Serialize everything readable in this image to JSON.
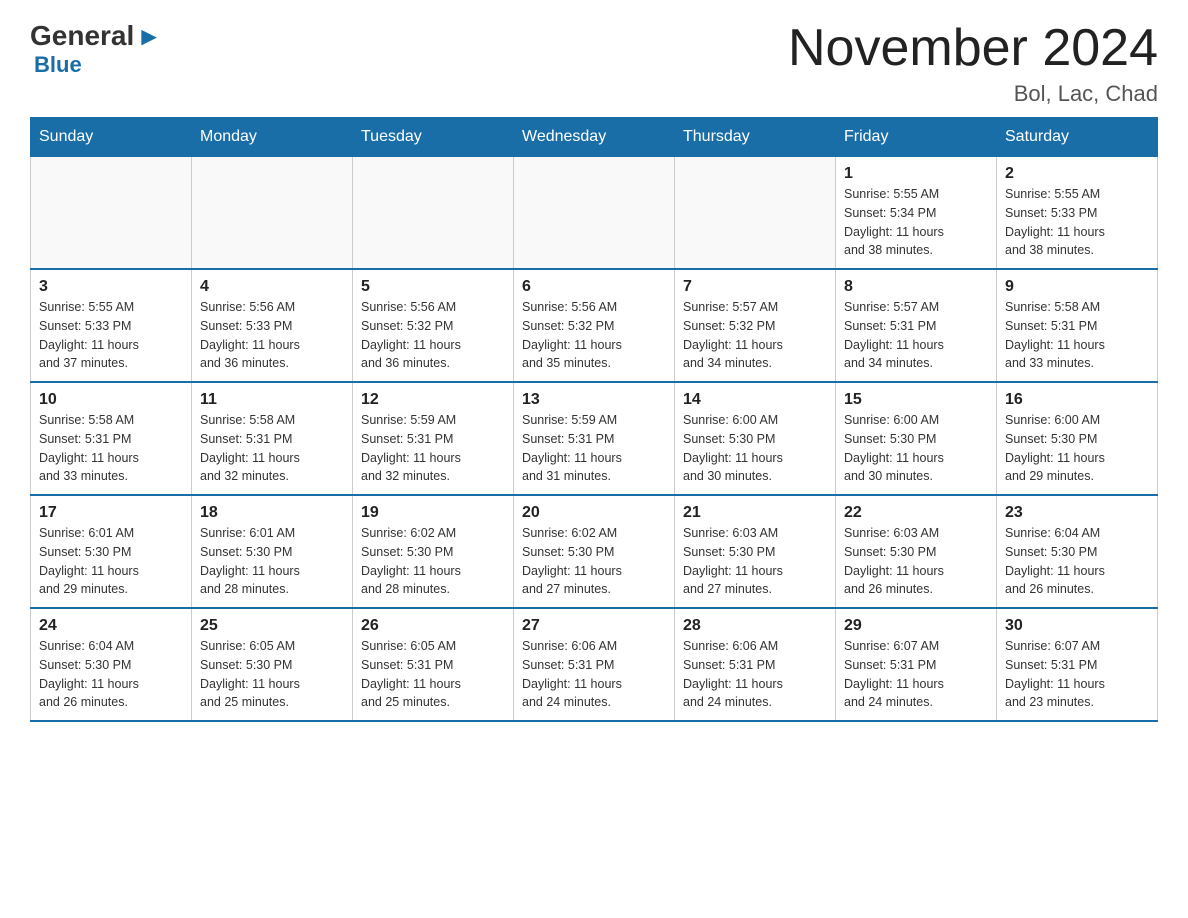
{
  "logo": {
    "general": "General",
    "arrow": "▶",
    "blue": "Blue"
  },
  "title": "November 2024",
  "subtitle": "Bol, Lac, Chad",
  "headers": [
    "Sunday",
    "Monday",
    "Tuesday",
    "Wednesday",
    "Thursday",
    "Friday",
    "Saturday"
  ],
  "weeks": [
    [
      {
        "day": "",
        "info": ""
      },
      {
        "day": "",
        "info": ""
      },
      {
        "day": "",
        "info": ""
      },
      {
        "day": "",
        "info": ""
      },
      {
        "day": "",
        "info": ""
      },
      {
        "day": "1",
        "info": "Sunrise: 5:55 AM\nSunset: 5:34 PM\nDaylight: 11 hours\nand 38 minutes."
      },
      {
        "day": "2",
        "info": "Sunrise: 5:55 AM\nSunset: 5:33 PM\nDaylight: 11 hours\nand 38 minutes."
      }
    ],
    [
      {
        "day": "3",
        "info": "Sunrise: 5:55 AM\nSunset: 5:33 PM\nDaylight: 11 hours\nand 37 minutes."
      },
      {
        "day": "4",
        "info": "Sunrise: 5:56 AM\nSunset: 5:33 PM\nDaylight: 11 hours\nand 36 minutes."
      },
      {
        "day": "5",
        "info": "Sunrise: 5:56 AM\nSunset: 5:32 PM\nDaylight: 11 hours\nand 36 minutes."
      },
      {
        "day": "6",
        "info": "Sunrise: 5:56 AM\nSunset: 5:32 PM\nDaylight: 11 hours\nand 35 minutes."
      },
      {
        "day": "7",
        "info": "Sunrise: 5:57 AM\nSunset: 5:32 PM\nDaylight: 11 hours\nand 34 minutes."
      },
      {
        "day": "8",
        "info": "Sunrise: 5:57 AM\nSunset: 5:31 PM\nDaylight: 11 hours\nand 34 minutes."
      },
      {
        "day": "9",
        "info": "Sunrise: 5:58 AM\nSunset: 5:31 PM\nDaylight: 11 hours\nand 33 minutes."
      }
    ],
    [
      {
        "day": "10",
        "info": "Sunrise: 5:58 AM\nSunset: 5:31 PM\nDaylight: 11 hours\nand 33 minutes."
      },
      {
        "day": "11",
        "info": "Sunrise: 5:58 AM\nSunset: 5:31 PM\nDaylight: 11 hours\nand 32 minutes."
      },
      {
        "day": "12",
        "info": "Sunrise: 5:59 AM\nSunset: 5:31 PM\nDaylight: 11 hours\nand 32 minutes."
      },
      {
        "day": "13",
        "info": "Sunrise: 5:59 AM\nSunset: 5:31 PM\nDaylight: 11 hours\nand 31 minutes."
      },
      {
        "day": "14",
        "info": "Sunrise: 6:00 AM\nSunset: 5:30 PM\nDaylight: 11 hours\nand 30 minutes."
      },
      {
        "day": "15",
        "info": "Sunrise: 6:00 AM\nSunset: 5:30 PM\nDaylight: 11 hours\nand 30 minutes."
      },
      {
        "day": "16",
        "info": "Sunrise: 6:00 AM\nSunset: 5:30 PM\nDaylight: 11 hours\nand 29 minutes."
      }
    ],
    [
      {
        "day": "17",
        "info": "Sunrise: 6:01 AM\nSunset: 5:30 PM\nDaylight: 11 hours\nand 29 minutes."
      },
      {
        "day": "18",
        "info": "Sunrise: 6:01 AM\nSunset: 5:30 PM\nDaylight: 11 hours\nand 28 minutes."
      },
      {
        "day": "19",
        "info": "Sunrise: 6:02 AM\nSunset: 5:30 PM\nDaylight: 11 hours\nand 28 minutes."
      },
      {
        "day": "20",
        "info": "Sunrise: 6:02 AM\nSunset: 5:30 PM\nDaylight: 11 hours\nand 27 minutes."
      },
      {
        "day": "21",
        "info": "Sunrise: 6:03 AM\nSunset: 5:30 PM\nDaylight: 11 hours\nand 27 minutes."
      },
      {
        "day": "22",
        "info": "Sunrise: 6:03 AM\nSunset: 5:30 PM\nDaylight: 11 hours\nand 26 minutes."
      },
      {
        "day": "23",
        "info": "Sunrise: 6:04 AM\nSunset: 5:30 PM\nDaylight: 11 hours\nand 26 minutes."
      }
    ],
    [
      {
        "day": "24",
        "info": "Sunrise: 6:04 AM\nSunset: 5:30 PM\nDaylight: 11 hours\nand 26 minutes."
      },
      {
        "day": "25",
        "info": "Sunrise: 6:05 AM\nSunset: 5:30 PM\nDaylight: 11 hours\nand 25 minutes."
      },
      {
        "day": "26",
        "info": "Sunrise: 6:05 AM\nSunset: 5:31 PM\nDaylight: 11 hours\nand 25 minutes."
      },
      {
        "day": "27",
        "info": "Sunrise: 6:06 AM\nSunset: 5:31 PM\nDaylight: 11 hours\nand 24 minutes."
      },
      {
        "day": "28",
        "info": "Sunrise: 6:06 AM\nSunset: 5:31 PM\nDaylight: 11 hours\nand 24 minutes."
      },
      {
        "day": "29",
        "info": "Sunrise: 6:07 AM\nSunset: 5:31 PM\nDaylight: 11 hours\nand 24 minutes."
      },
      {
        "day": "30",
        "info": "Sunrise: 6:07 AM\nSunset: 5:31 PM\nDaylight: 11 hours\nand 23 minutes."
      }
    ]
  ]
}
